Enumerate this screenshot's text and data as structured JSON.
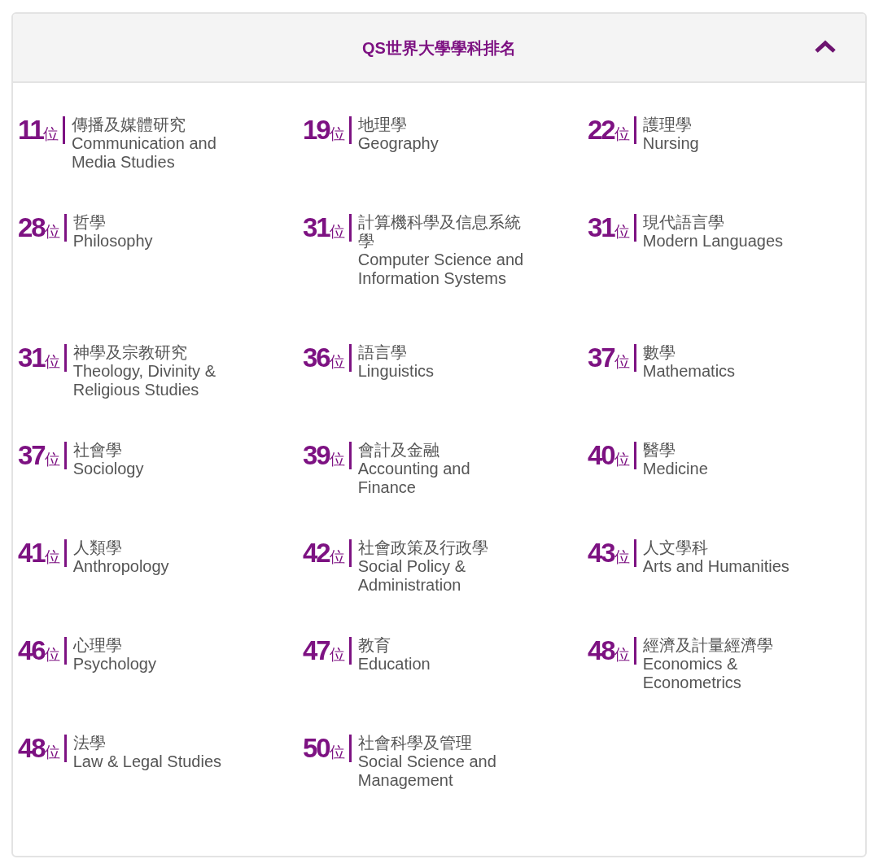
{
  "panel": {
    "title": "QS世界大學學科排名",
    "expanded": true
  },
  "subjects": [
    {
      "rank": "11",
      "unit": "位",
      "name_zh": "傳播及媒體研究",
      "name_en": "Communication and Media Studies"
    },
    {
      "rank": "19",
      "unit": "位",
      "name_zh": "地理學",
      "name_en": "Geography"
    },
    {
      "rank": "22",
      "unit": "位",
      "name_zh": "護理學",
      "name_en": "Nursing"
    },
    {
      "rank": "28",
      "unit": "位",
      "name_zh": "哲學",
      "name_en": "Philosophy"
    },
    {
      "rank": "31",
      "unit": "位",
      "name_zh": "計算機科學及信息系統學",
      "name_en": "Computer Science and Information Systems"
    },
    {
      "rank": "31",
      "unit": "位",
      "name_zh": "現代語言學",
      "name_en": "Modern Languages"
    },
    {
      "rank": "31",
      "unit": "位",
      "name_zh": "神學及宗教研究",
      "name_en": "Theology, Divinity & Religious Studies"
    },
    {
      "rank": "36",
      "unit": "位",
      "name_zh": "語言學",
      "name_en": "Linguistics"
    },
    {
      "rank": "37",
      "unit": "位",
      "name_zh": "數學",
      "name_en": "Mathematics"
    },
    {
      "rank": "37",
      "unit": "位",
      "name_zh": "社會學",
      "name_en": "Sociology"
    },
    {
      "rank": "39",
      "unit": "位",
      "name_zh": "會計及金融",
      "name_en": "Accounting and Finance"
    },
    {
      "rank": "40",
      "unit": "位",
      "name_zh": "醫學",
      "name_en": "Medicine"
    },
    {
      "rank": "41",
      "unit": "位",
      "name_zh": "人類學",
      "name_en": "Anthropology"
    },
    {
      "rank": "42",
      "unit": "位",
      "name_zh": "社會政策及行政學",
      "name_en": "Social Policy & Administration"
    },
    {
      "rank": "43",
      "unit": "位",
      "name_zh": "人文學科",
      "name_en": "Arts and Humanities"
    },
    {
      "rank": "46",
      "unit": "位",
      "name_zh": "心理學",
      "name_en": "Psychology"
    },
    {
      "rank": "47",
      "unit": "位",
      "name_zh": "教育",
      "name_en": "Education"
    },
    {
      "rank": "48",
      "unit": "位",
      "name_zh": "經濟及計量經濟學",
      "name_en": "Economics & Econometrics"
    },
    {
      "rank": "48",
      "unit": "位",
      "name_zh": "法學",
      "name_en": "Law & Legal Studies"
    },
    {
      "rank": "50",
      "unit": "位",
      "name_zh": "社會科學及管理",
      "name_en": "Social Science and Management"
    }
  ]
}
